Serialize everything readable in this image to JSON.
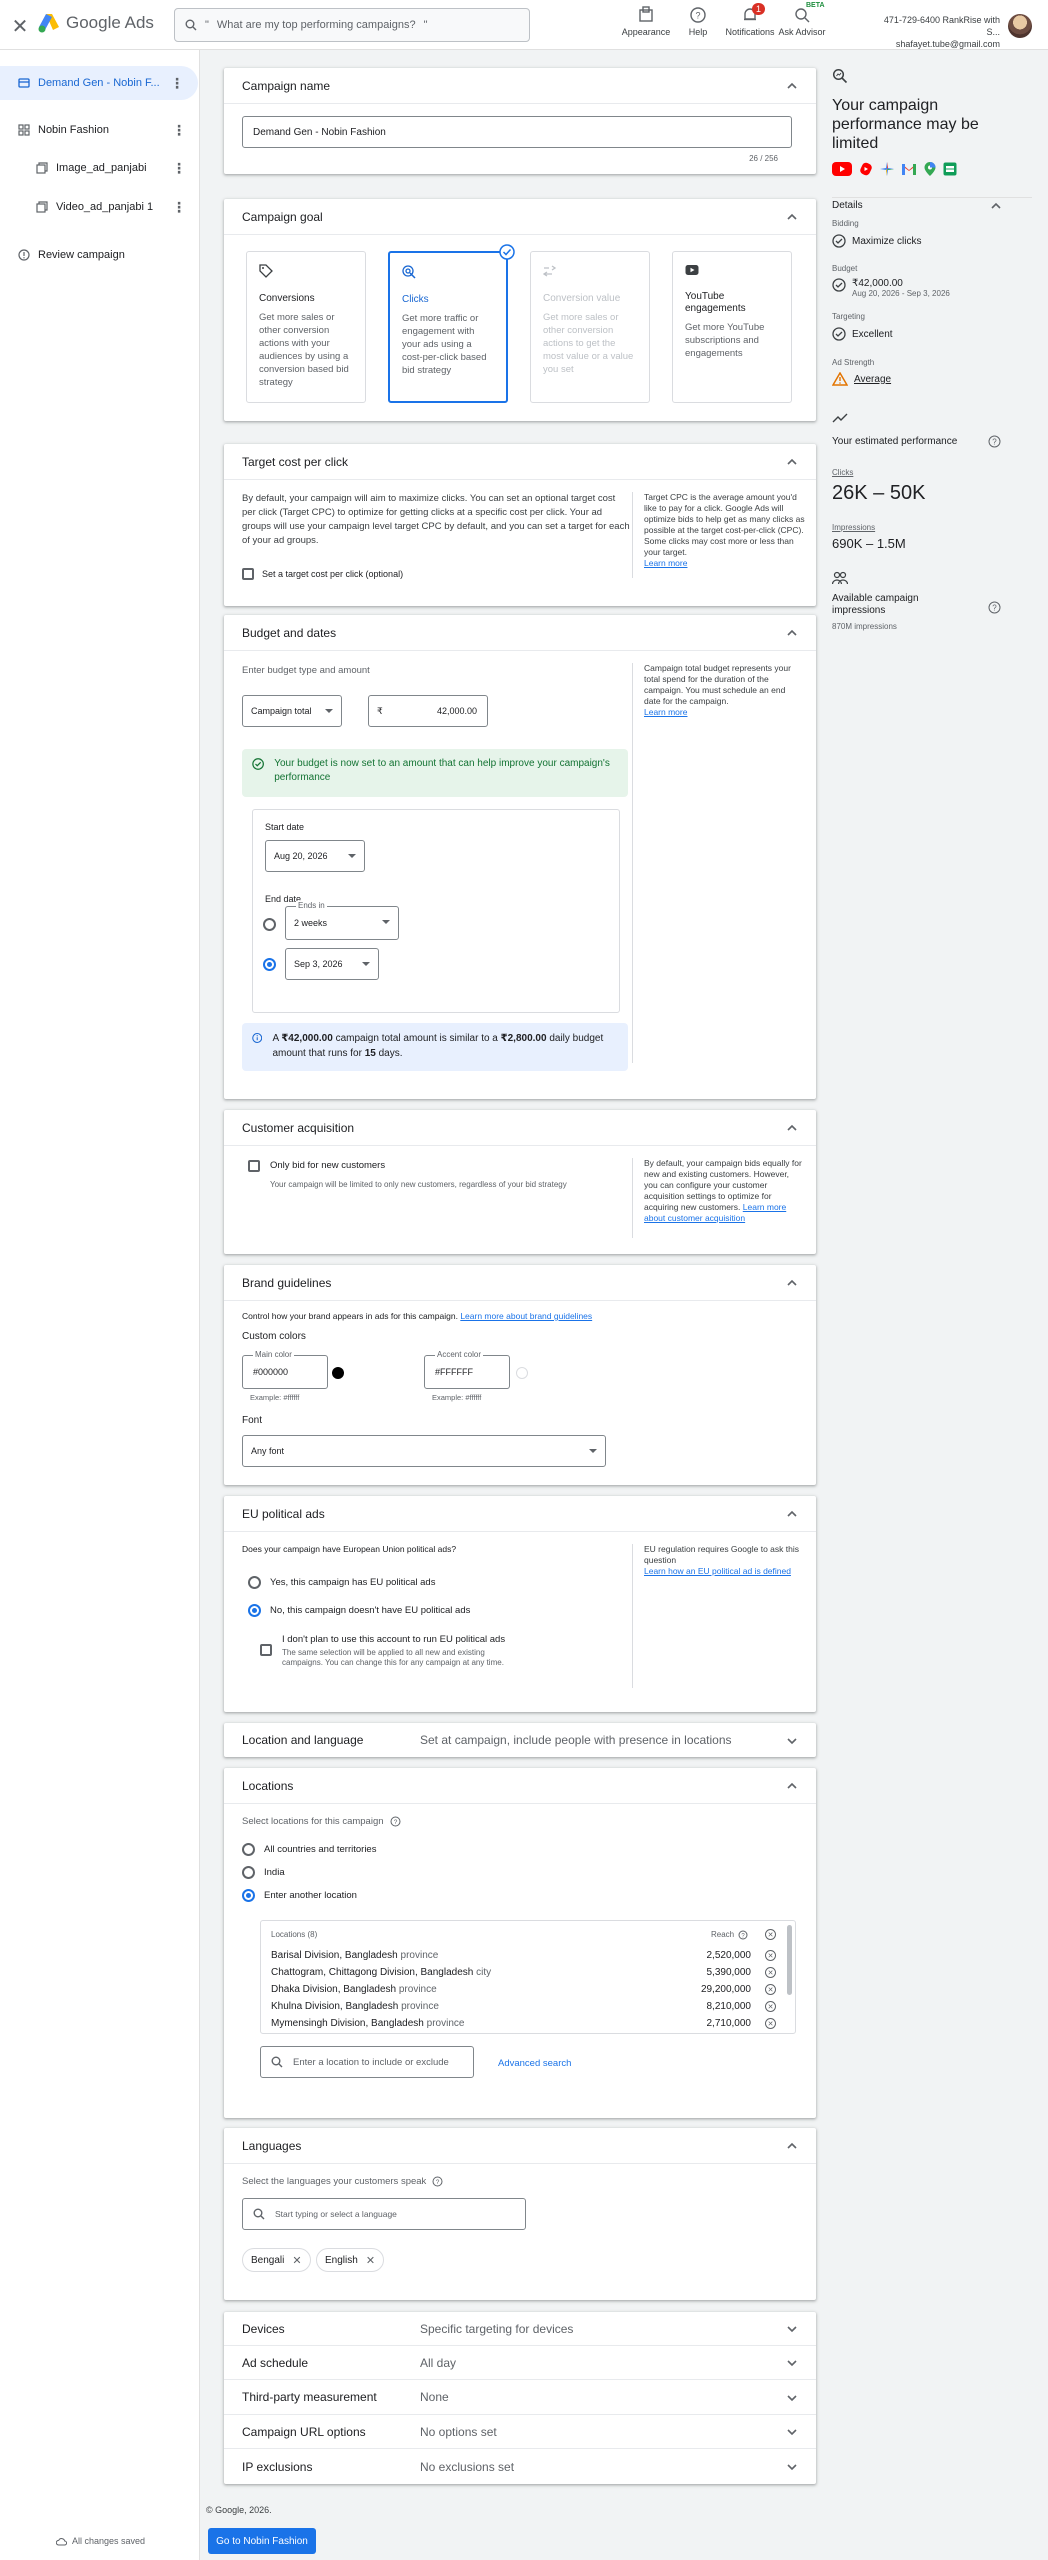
{
  "topbar": {
    "app_name": "Google Ads",
    "search_placeholder": "What are my top performing campaigns?",
    "actions": [
      "Appearance",
      "Help",
      "Notifications",
      "Ask Advisor"
    ],
    "notifications_count": "1",
    "beta_label": "BETA",
    "account_id": "471-729-6400 RankRise with S...",
    "account_email": "shafayet.tube@gmail.com"
  },
  "leftnav": {
    "items": [
      {
        "label": "Demand Gen - Nobin F..."
      },
      {
        "label": "Nobin Fashion"
      },
      {
        "label": "Image_ad_panjabi"
      },
      {
        "label": "Video_ad_panjabi 1"
      },
      {
        "label": "Review campaign"
      }
    ],
    "saved_label": "All changes saved"
  },
  "campaign_name": {
    "header": "Campaign name",
    "value": "Demand Gen - Nobin Fashion",
    "counter": "26 / 256"
  },
  "campaign_goal": {
    "header": "Campaign goal",
    "tiles": [
      {
        "title": "Conversions",
        "desc": "Get more sales or other conversion actions with your audiences by using a conversion based bid strategy"
      },
      {
        "title": "Clicks",
        "desc": "Get more traffic or engagement with your ads using a cost-per-click based bid strategy"
      },
      {
        "title": "Conversion value",
        "desc": "Get more sales or other conversion actions to get the most value or a value you set"
      },
      {
        "title": "YouTube engagements",
        "desc": "Get more YouTube subscriptions and engagements"
      }
    ]
  },
  "target_cpc": {
    "header": "Target cost per click",
    "body": "By default, your campaign will aim to maximize clicks. You can set an optional target cost per click (Target CPC) to optimize for getting clicks at a specific cost per click. Your ad groups will use your campaign level target CPC by default, and you can set a target for each of your ad groups.",
    "checkbox_label": "Set a target cost per click (optional)",
    "help": "Target CPC is the average amount you'd like to pay for a click. Google Ads will optimize bids to help get as many clicks as possible at the target cost-per-click (CPC). Some clicks may cost more or less than your target.",
    "learn_more": "Learn more"
  },
  "budget": {
    "header": "Budget and dates",
    "prompt": "Enter budget type and amount",
    "type": "Campaign total",
    "currency": "₹",
    "amount": "42,000.00",
    "help": "Campaign total budget represents your total spend for the duration of the campaign. You must schedule an end date for the campaign.",
    "learn_more": "Learn more",
    "notice": "Your budget is now set to an amount that can help improve your campaign's performance",
    "start_label": "Start date",
    "start_date": "Aug 20, 2026",
    "end_label": "End date",
    "ends_in_label": "Ends in",
    "ends_in": "2 weeks",
    "end_date": "Sep 3, 2026",
    "info_prefix": "A ",
    "info_total": "₹42,000.00",
    "info_mid": " campaign total amount is similar to a ",
    "info_daily": "₹2,800.00",
    "info_mid2": " daily budget amount that runs for ",
    "info_days": "15",
    "info_suffix": " days."
  },
  "customer_acquisition": {
    "header": "Customer acquisition",
    "checkbox_label": "Only bid for new customers",
    "sub": "Your campaign will be limited to only new customers, regardless of your bid strategy",
    "help": "By default, your campaign bids equally for new and existing customers. However, you can configure your customer acquisition settings to optimize for acquiring new customers.",
    "learn_more": "Learn more about customer acquisition"
  },
  "brand": {
    "header": "Brand guidelines",
    "intro": "Control how your brand appears in ads for this campaign.",
    "intro_link": "Learn more about brand guidelines",
    "custom_colors": "Custom colors",
    "main_color_label": "Main color",
    "main_color": "#000000",
    "accent_color_label": "Accent color",
    "accent_color": "#FFFFFF",
    "example": "Example: #ffffff",
    "font_label": "Font",
    "font_value": "Any font"
  },
  "eu_political": {
    "header": "EU political ads",
    "question": "Does your campaign have European Union political ads?",
    "opt_yes": "Yes, this campaign has EU political ads",
    "opt_no": "No, this campaign doesn't have EU political ads",
    "check_label": "I don't plan to use this account to run EU political ads",
    "check_sub": "The same selection will be applied to all new and existing campaigns. You can change this for any campaign at any time.",
    "help": "EU regulation requires Google to ask this question",
    "help_link": "Learn how an EU political ad is defined"
  },
  "location_language": {
    "header": "Location and language",
    "summary": "Set at campaign, include people with presence in locations"
  },
  "locations": {
    "header": "Locations",
    "prompt": "Select locations for this campaign",
    "opt_all": "All countries and territories",
    "opt_india": "India",
    "opt_other": "Enter another location",
    "list_header": "Locations (8)",
    "reach_header": "Reach",
    "rows": [
      {
        "name": "Barisal Division, Bangladesh",
        "kind": "province",
        "reach": "2,520,000"
      },
      {
        "name": "Chattogram, Chittagong Division, Bangladesh",
        "kind": "city",
        "reach": "5,390,000"
      },
      {
        "name": "Dhaka Division, Bangladesh",
        "kind": "province",
        "reach": "29,200,000"
      },
      {
        "name": "Khulna Division, Bangladesh",
        "kind": "province",
        "reach": "8,210,000"
      },
      {
        "name": "Mymensingh Division, Bangladesh",
        "kind": "province",
        "reach": "2,710,000"
      }
    ],
    "search_placeholder": "Enter a location to include or exclude",
    "advanced": "Advanced search"
  },
  "languages": {
    "header": "Languages",
    "prompt": "Select the languages your customers speak",
    "search_placeholder": "Start typing or select a language",
    "chips": [
      "Bengali",
      "English"
    ]
  },
  "collapsed_rows": [
    {
      "label": "Devices",
      "summary": "Specific targeting for devices"
    },
    {
      "label": "Ad schedule",
      "summary": "All day"
    },
    {
      "label": "Third-party measurement",
      "summary": "None"
    },
    {
      "label": "Campaign URL options",
      "summary": "No options set"
    },
    {
      "label": "IP exclusions",
      "summary": "No exclusions set"
    }
  ],
  "footer": {
    "copyright": "© Google, 2026.",
    "button": "Go to Nobin Fashion"
  },
  "right_panel": {
    "title": "Your campaign performance may be limited",
    "details_label": "Details",
    "bidding_label": "Bidding",
    "bidding_value": "Maximize clicks",
    "budget_label": "Budget",
    "budget_value": "₹42,000.00",
    "budget_dates": "Aug 20, 2026 - Sep 3, 2026",
    "targeting_label": "Targeting",
    "targeting_value": "Excellent",
    "strength_label": "Ad Strength",
    "strength_value": "Average",
    "est_label": "Your estimated performance",
    "clicks_label": "Clicks",
    "clicks_value": "26K – 50K",
    "impr_label": "Impressions",
    "impr_value": "690K – 1.5M",
    "avail_label": "Available campaign impressions",
    "avail_value": "870M impressions"
  }
}
